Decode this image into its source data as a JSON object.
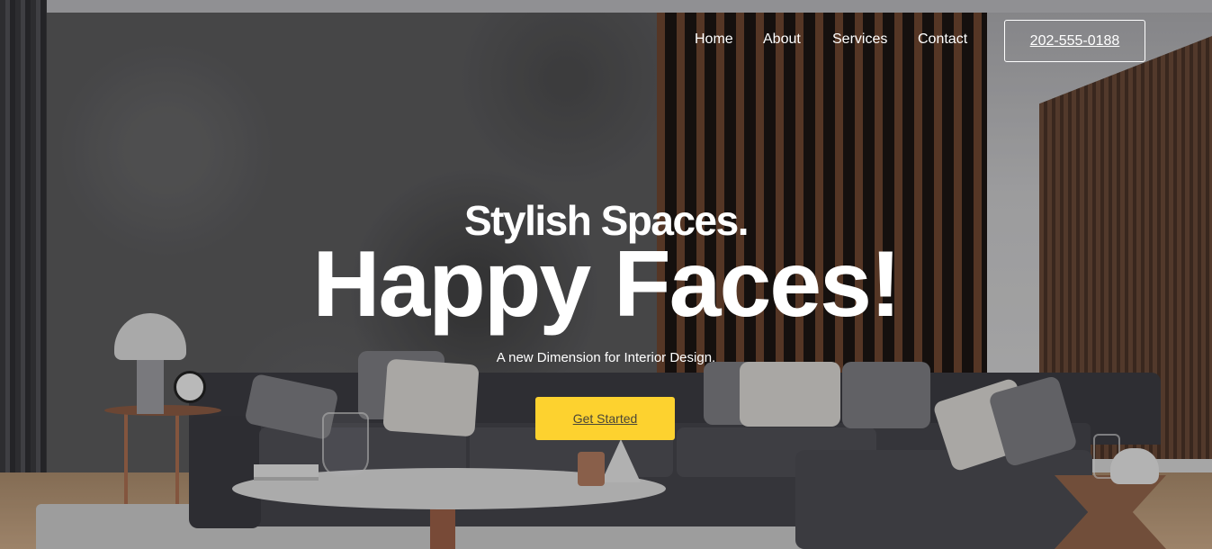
{
  "nav": {
    "links": [
      {
        "label": "Home"
      },
      {
        "label": "About"
      },
      {
        "label": "Services"
      },
      {
        "label": "Contact"
      }
    ],
    "phone": "202-555-0188"
  },
  "hero": {
    "headline_small": "Stylish Spaces.",
    "headline_big": "Happy Faces!",
    "tagline": "A new Dimension for Interior Design.",
    "cta_label": "Get Started"
  },
  "colors": {
    "cta_background": "#fdd22f",
    "cta_text": "#4b4637",
    "nav_text": "#ffffff"
  }
}
